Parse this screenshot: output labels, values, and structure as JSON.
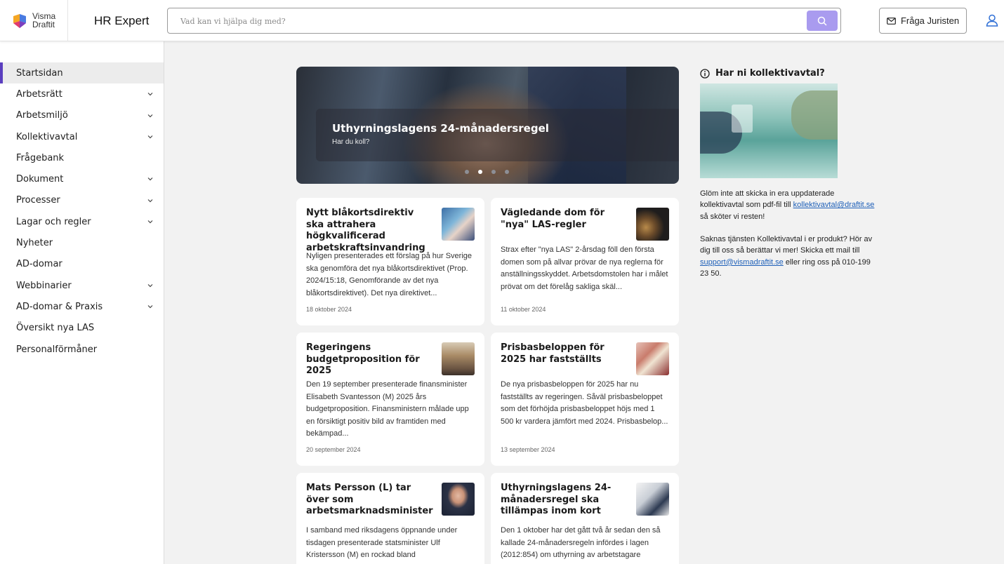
{
  "header": {
    "logo_line1": "Visma",
    "logo_line2": "Draftit",
    "app_title": "HR Expert",
    "search_placeholder": "Vad kan vi hjälpa dig med?",
    "ask_button": "Fråga Juristen"
  },
  "sidebar": {
    "items": [
      {
        "label": "Startsidan",
        "has_children": false,
        "active": true
      },
      {
        "label": "Arbetsrätt",
        "has_children": true
      },
      {
        "label": "Arbetsmiljö",
        "has_children": true
      },
      {
        "label": "Kollektivavtal",
        "has_children": true
      },
      {
        "label": "Frågebank",
        "has_children": false
      },
      {
        "label": "Dokument",
        "has_children": true
      },
      {
        "label": "Processer",
        "has_children": true
      },
      {
        "label": "Lagar och regler",
        "has_children": true
      },
      {
        "label": "Nyheter",
        "has_children": false
      },
      {
        "label": "AD-domar",
        "has_children": false
      },
      {
        "label": "Webbinarier",
        "has_children": true
      },
      {
        "label": "AD-domar & Praxis",
        "has_children": true
      },
      {
        "label": "Översikt nya LAS",
        "has_children": false
      },
      {
        "label": "Personalförmåner",
        "has_children": false
      }
    ]
  },
  "hero": {
    "title": "Uthyrningslagens 24-månadersregel",
    "subtitle": "Har du koll?",
    "slides": 4,
    "active_slide": 2
  },
  "cards": [
    {
      "title": "Nytt blåkortsdirektiv ska attrahera högkvalificerad arbetskraftsinvandring",
      "text": "Nyligen presenterades ett förslag på hur Sverige ska genomföra det nya blåkortsdirektivet (Prop. 2024/15:18, Genomförande av det nya blåkortsdirektivet). Det nya direktivet...",
      "date": "18 oktober 2024"
    },
    {
      "title": "Vägledande dom för \"nya\" LAS-regler",
      "text": "Strax efter \"nya LAS\" 2-årsdag föll den första domen som på allvar prövar de nya reglerna för anställningsskyddet. Arbetsdomstolen har i målet prövat om det förelåg sakliga skäl...",
      "date": "11 oktober 2024"
    },
    {
      "title": "Regeringens budgetproposition för 2025",
      "text": "Den 19 september presenterade finansminister Elisabeth Svantesson (M) 2025 års budgetproposition. Finansministern målade upp en försiktigt positiv bild av framtiden med bekämpad...",
      "date": "20 september 2024"
    },
    {
      "title": "Prisbasbeloppen för 2025 har fastställts",
      "text": "De nya prisbasbeloppen för 2025 har nu fastställts av regeringen. Såväl prisbasbeloppet som det förhöjda prisbasbeloppet höjs med 1 500 kr vardera jämfört med 2024. Prisbasbelop...",
      "date": "13 september 2024"
    },
    {
      "title": "Mats Persson (L) tar över som arbetsmarknadsminister",
      "text": "I samband med riksdagens öppnande under tisdagen presenterade statsminister Ulf Kristersson (M) en rockad bland",
      "date": ""
    },
    {
      "title": "Uthyrningslagens 24-månadersregel ska tillämpas inom kort",
      "text": "Den 1 oktober har det gått två år sedan den så kallade 24-månadersregeln infördes i lagen (2012:854) om uthyrning av arbetstagare",
      "date": ""
    }
  ],
  "aside": {
    "heading": "Har ni kollektivavtal?",
    "p1_before": "Glöm inte att skicka in era uppdaterade kollektivavtal som pdf-fil till ",
    "p1_link": "kollektivavtal@draftit.se",
    "p1_after": " så sköter vi resten!",
    "p2_before": "Saknas tjänsten Kollektivavtal i er produkt? Hör av dig till oss så berättar vi mer! Skicka ett mail till ",
    "p2_link": "support@vismadraftit.se",
    "p2_after": " eller ring oss på 010-199 23 50."
  },
  "colors": {
    "accent": "#5b3fbf",
    "search_button": "#a99bef",
    "link": "#1d5fb8"
  }
}
